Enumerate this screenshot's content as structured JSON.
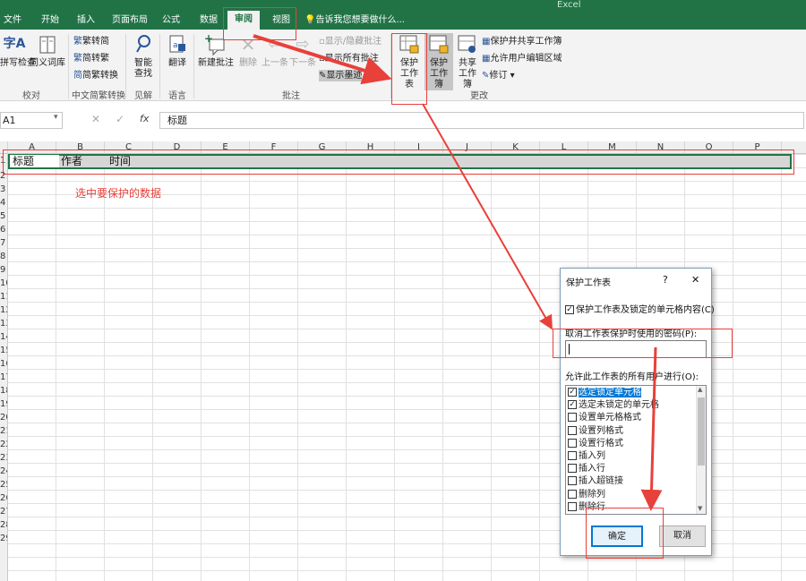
{
  "window": {
    "title": "Excel"
  },
  "tabs": [
    "文件",
    "开始",
    "插入",
    "页面布局",
    "公式",
    "数据",
    "审阅",
    "视图"
  ],
  "tell_me": "告诉我您想要做什么...",
  "ribbon": {
    "proofing": {
      "spell": "拼写检查",
      "thesaurus": "同义词库",
      "label": "校对"
    },
    "chinese": {
      "t2s": "繁转简",
      "s2t": "简转繁",
      "convert": "简繁转换",
      "label": "中文简繁转换"
    },
    "insights": {
      "smart": "智能查找",
      "label": "见解"
    },
    "language": {
      "translate": "翻译",
      "label": "语言"
    },
    "comments": {
      "new": "新建批注",
      "delete": "删除",
      "prev": "上一条",
      "next": "下一条",
      "show_hide": "显示/隐藏批注",
      "show_all": "显示所有批注",
      "show_ink": "显示墨迹",
      "label": "批注"
    },
    "changes": {
      "protect_sheet": "保护工作表",
      "protect_book": "保护工作簿",
      "share_book": "共享工作簿",
      "protect_share": "保护并共享工作簿",
      "allow_edit": "允许用户编辑区域",
      "track": "修订",
      "label": "更改"
    }
  },
  "formula_bar": {
    "name_box": "A1",
    "value": "标题"
  },
  "columns": [
    "A",
    "B",
    "C",
    "D",
    "E",
    "F",
    "G",
    "H",
    "I",
    "J",
    "K",
    "L",
    "M",
    "N",
    "O",
    "P"
  ],
  "rows": [
    "1",
    "2",
    "3",
    "4",
    "5",
    "6",
    "7",
    "8",
    "9",
    "10",
    "11",
    "12",
    "13",
    "14",
    "15",
    "16",
    "17",
    "18",
    "19",
    "20",
    "21",
    "22",
    "23",
    "24",
    "25",
    "26",
    "27",
    "28",
    "29"
  ],
  "cells": {
    "a1": "标题",
    "b1": "作者",
    "c1": "时间"
  },
  "annotation": "选中要保护的数据",
  "dialog": {
    "title": "保护工作表",
    "help": "?",
    "close": "✕",
    "protect_check_label": "保护工作表及锁定的单元格内容(C)",
    "password_label": "取消工作表保护时使用的密码(P):",
    "password_value": "",
    "allow_label": "允许此工作表的所有用户进行(O):",
    "permissions": [
      {
        "label": "选定锁定单元格",
        "checked": true
      },
      {
        "label": "选定未锁定的单元格",
        "checked": true
      },
      {
        "label": "设置单元格格式",
        "checked": false
      },
      {
        "label": "设置列格式",
        "checked": false
      },
      {
        "label": "设置行格式",
        "checked": false
      },
      {
        "label": "插入列",
        "checked": false
      },
      {
        "label": "插入行",
        "checked": false
      },
      {
        "label": "插入超链接",
        "checked": false
      },
      {
        "label": "删除列",
        "checked": false
      },
      {
        "label": "删除行",
        "checked": false
      }
    ],
    "ok": "确定",
    "cancel": "取消"
  },
  "colors": {
    "accent": "#217346",
    "annotation": "#e8403a",
    "selection": "#0078d7"
  }
}
